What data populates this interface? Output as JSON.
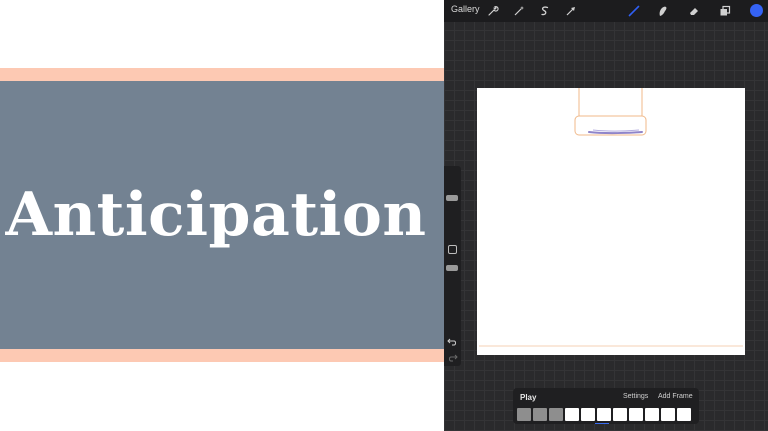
{
  "title_card": {
    "title": "Anticipation",
    "colors": {
      "band": "#fdc9b3",
      "panel": "#738292",
      "text": "#ffffff"
    }
  },
  "toolbar": {
    "gallery_label": "Gallery",
    "left_tools": [
      "wrench-icon",
      "magic-wand-icon",
      "selection-icon",
      "transform-arrow-icon"
    ],
    "right_tools": [
      "brush-icon",
      "smudge-icon",
      "eraser-icon",
      "layers-icon",
      "color-swatch"
    ],
    "active_tool": "brush-icon",
    "accent_color": "#2f5ff3",
    "current_color": "#3563f5"
  },
  "sidebar": {
    "items": [
      "brush-size-slider",
      "modify-button",
      "opacity-slider",
      "undo-icon",
      "redo-icon"
    ]
  },
  "animation": {
    "play_label": "Play",
    "settings_label": "Settings",
    "add_frame_label": "Add Frame",
    "frames": [
      "onion",
      "onion",
      "onion",
      "blank",
      "blank",
      "blank",
      "blank",
      "blank",
      "blank",
      "blank",
      "blank"
    ]
  }
}
